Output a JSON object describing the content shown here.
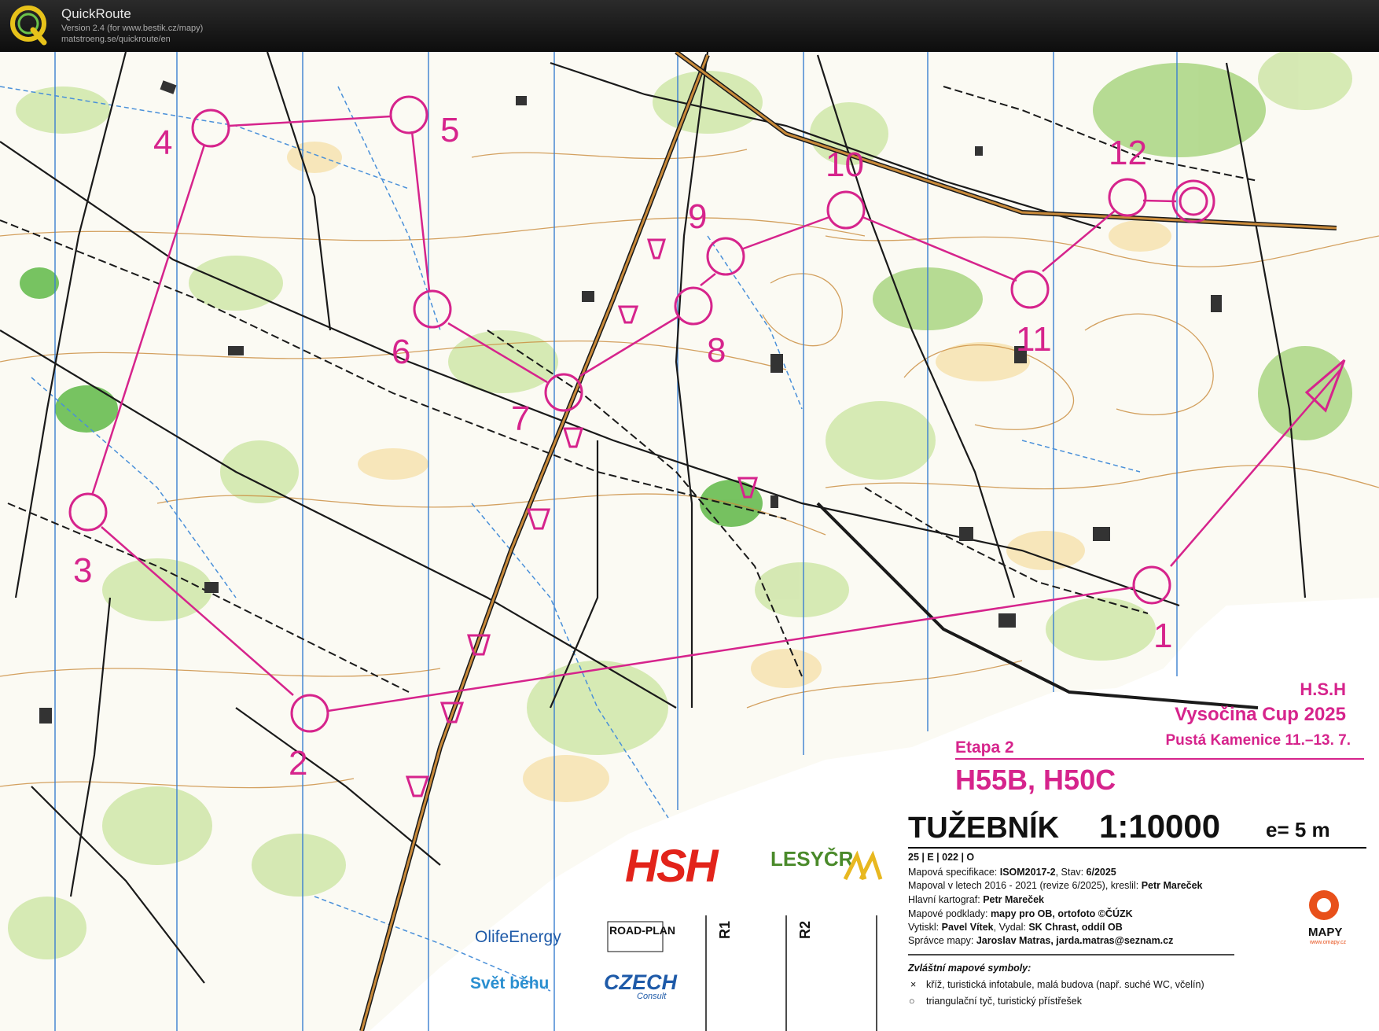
{
  "app": {
    "name": "QuickRoute",
    "version": "Version 2.4  (for www.bestik.cz/mapy)",
    "url": "matstroeng.se/quickroute/en",
    "icon": "quickroute-logo-icon"
  },
  "course": {
    "controls": [
      {
        "label": "1"
      },
      {
        "label": "2"
      },
      {
        "label": "3"
      },
      {
        "label": "4"
      },
      {
        "label": "5"
      },
      {
        "label": "6"
      },
      {
        "label": "7"
      },
      {
        "label": "8"
      },
      {
        "label": "9"
      },
      {
        "label": "10"
      },
      {
        "label": "11"
      },
      {
        "label": "12"
      }
    ],
    "color": "#d6248c"
  },
  "event": {
    "organizer": "H.S.H",
    "title": "Vysočina Cup 2025",
    "place_dates": "Pustá Kamenice  11.–13. 7.",
    "stage": "Etapa 2",
    "categories": "H55B, H50C"
  },
  "map_info": {
    "name": "TUŽEBNÍK",
    "scale": "1:10000",
    "contour": "e= 5 m",
    "code": "25 | E | 022 | O",
    "lines": [
      {
        "label": "Mapová specifikace: ",
        "value": "ISOM2017-2",
        "label2": ", Stav: ",
        "value2": "6/2025"
      },
      {
        "label": "Mapoval v letech 2016 - 2021 (revize 6/2025), kreslil: ",
        "value": "Petr Mareček",
        "label2": "",
        "value2": ""
      },
      {
        "label": "Hlavní kartograf: ",
        "value": "Petr Mareček",
        "label2": "",
        "value2": ""
      },
      {
        "label": "Mapové podklady: ",
        "value": "mapy pro OB, ortofoto ©ČÚZK",
        "label2": "",
        "value2": ""
      },
      {
        "label": "Vytiskl: ",
        "value": "Pavel Vítek",
        "label2": ", Vydal: ",
        "value2": "SK Chrast, oddíl OB"
      },
      {
        "label": "Správce mapy: ",
        "value": "Jaroslav Matras, jarda.matras@seznam.cz",
        "label2": "",
        "value2": ""
      }
    ],
    "special_title": "Zvláštní mapové symboly:",
    "special": [
      {
        "symbol": "×",
        "text": "kříž, turistická infotabule, malá budova (např. suché WC, včelín)"
      },
      {
        "symbol": "○",
        "text": "triangulační tyč, turistický přístřešek"
      }
    ],
    "r1": "R1",
    "r2": "R2"
  },
  "sponsors": {
    "hsh": "HSH",
    "lesy": "LESYČR",
    "olife": "OlifeEnergy",
    "roadplan": "ROAD-PLAN",
    "svet": "Svět běhu",
    "czech": "CZECH",
    "czech_sub": "Consult",
    "mapy": "MAPY",
    "mapy_url": "www.omapy.cz"
  }
}
